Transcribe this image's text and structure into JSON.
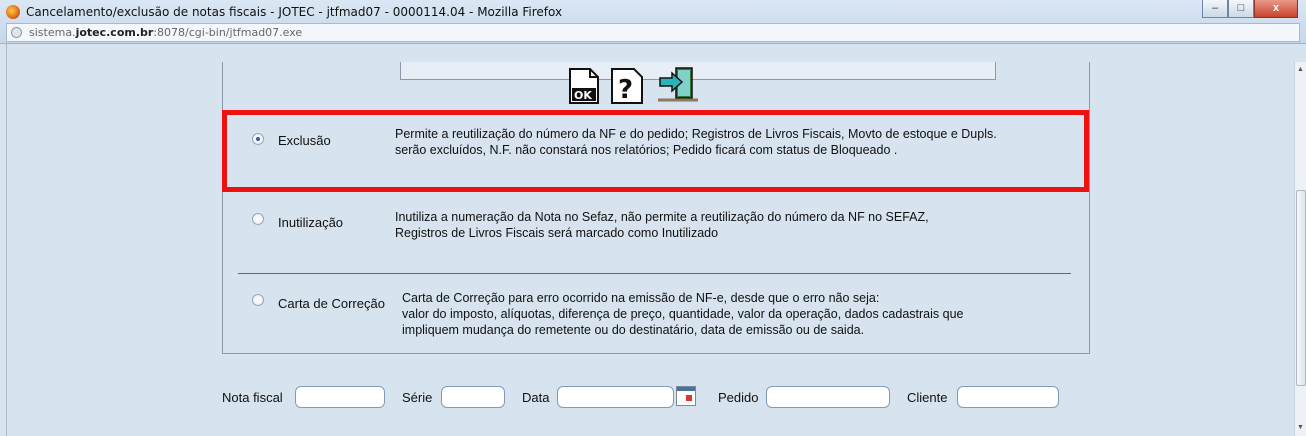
{
  "window": {
    "title": "Cancelamento/exclusão de notas fiscais - JOTEC - jtfmad07 - 0000114.04 - Mozilla Firefox",
    "url_prefix": "sistema.",
    "url_domain": "jotec.com.br",
    "url_rest": ":8078/cgi-bin/jtfmad07.exe",
    "minimize": "–",
    "maximize": "□",
    "close": "x"
  },
  "toolbar": {
    "ok_icon": "ok-document-icon",
    "help_icon": "help-question-icon",
    "exit_icon": "exit-door-icon"
  },
  "options": [
    {
      "label": "Exclusão",
      "selected": true,
      "desc_line1": "Permite a reutilização do número da NF e do pedido; Registros de Livros Fiscais, Movto de estoque e Dupls.",
      "desc_line2": "serão excluídos, N.F. não constará nos relatórios; Pedido ficará com status de Bloqueado ."
    },
    {
      "label": "Inutilização",
      "selected": false,
      "desc_line1": "Inutiliza a numeração da Nota no Sefaz, não permite a reutilização do número da NF no SEFAZ,",
      "desc_line2": "Registros de Livros Fiscais será marcado como Inutilizado"
    },
    {
      "label": "Carta de Correção",
      "selected": false,
      "desc_line1": "Carta de Correção para erro ocorrido na emissão de NF-e, desde que o erro não seja:",
      "desc_line2": "valor do imposto, alíquotas, diferença de preço, quantidade, valor da operação, dados cadastrais que",
      "desc_line3": "impliquem mudança do remetente ou do destinatário, data de emissão ou de saida."
    }
  ],
  "filters": {
    "nota_fiscal_label": "Nota fiscal",
    "nota_fiscal_value": "",
    "serie_label": "Série",
    "serie_value": "",
    "data_label": "Data",
    "data_value": "",
    "pedido_label": "Pedido",
    "pedido_value": "",
    "cliente_label": "Cliente",
    "cliente_value": ""
  },
  "colors": {
    "highlight": "#ee1111",
    "background": "#d7e3ee"
  }
}
